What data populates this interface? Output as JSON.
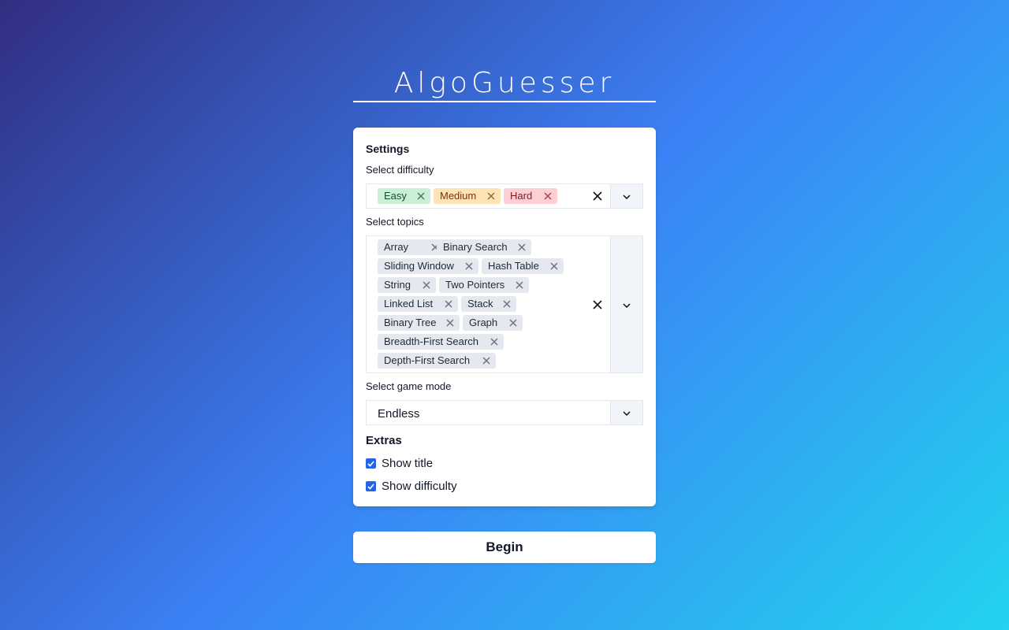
{
  "app": {
    "title": "AlgoGuesser"
  },
  "settings": {
    "heading": "Settings",
    "difficulty": {
      "label": "Select difficulty",
      "selected": [
        {
          "label": "Easy",
          "color": "#c9f0d4"
        },
        {
          "label": "Medium",
          "color": "#fde3b5"
        },
        {
          "label": "Hard",
          "color": "#fbcfd4"
        }
      ]
    },
    "topics": {
      "label": "Select topics",
      "selected": [
        "Array",
        "Binary Search",
        "Sliding Window",
        "Hash Table",
        "String",
        "Two Pointers",
        "Linked List",
        "Stack",
        "Binary Tree",
        "Graph",
        "Breadth-First Search",
        "Depth-First Search"
      ]
    },
    "game_mode": {
      "label": "Select game mode",
      "value": "Endless"
    },
    "extras": {
      "heading": "Extras",
      "options": [
        {
          "label": "Show title",
          "checked": true
        },
        {
          "label": "Show difficulty",
          "checked": true
        }
      ]
    }
  },
  "actions": {
    "begin_label": "Begin"
  },
  "colors": {
    "accent": "#2563eb",
    "gradient_start": "#312e81",
    "gradient_mid": "#3b82f6",
    "gradient_end": "#22d3ee"
  },
  "icons": {
    "remove": "x-icon",
    "clear": "clear-icon",
    "dropdown": "chevron-down-icon",
    "check": "checkmark-icon"
  }
}
